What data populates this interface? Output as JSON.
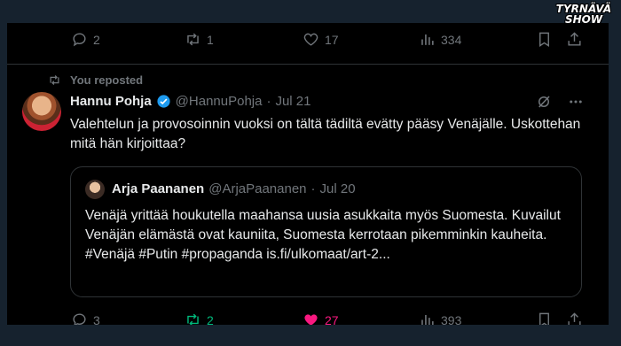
{
  "watermark": {
    "line1": "TYRNÄVÄ",
    "line2": "SHOW"
  },
  "prev_actions": {
    "reply_count": "2",
    "repost_count": "1",
    "like_count": "17",
    "views_count": "334"
  },
  "repost_label": "You reposted",
  "tweet": {
    "author_name": "Hannu Pohja",
    "handle": "@HannuPohja",
    "separator": "·",
    "date": "Jul 21",
    "text": "Valehtelun ja provosoinnin vuoksi on tältä tädiltä evätty pääsy Venäjälle. Uskottehan mitä hän kirjoittaa?",
    "quote": {
      "author_name": "Arja Paananen",
      "handle": "@ArjaPaananen",
      "separator": "·",
      "date": "Jul 20",
      "text": "Venäjä yrittää houkutella maahansa uusia asukkaita myös Suomesta. Kuvailut Venäjän elämästä ovat kauniita, Suomesta kerrotaan pikemminkin kauheita. #Venäjä #Putin #propaganda is.fi/ulkomaat/art-2..."
    },
    "actions": {
      "reply_count": "3",
      "repost_count": "2",
      "like_count": "27",
      "views_count": "393"
    }
  },
  "colors": {
    "background": "#000000",
    "frame": "#16222e",
    "muted": "#71767b",
    "verified": "#1d9bf0",
    "repost_active": "#00ba7c",
    "like_active": "#f91880"
  }
}
